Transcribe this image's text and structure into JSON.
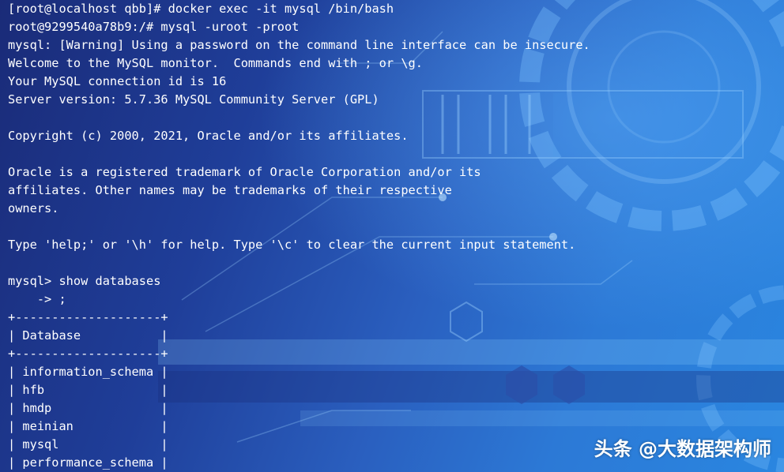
{
  "terminal": {
    "lines": [
      "[root@localhost qbb]# docker exec -it mysql /bin/bash",
      "root@9299540a78b9:/# mysql -uroot -proot",
      "mysql: [Warning] Using a password on the command line interface can be insecure.",
      "Welcome to the MySQL monitor.  Commands end with ; or \\g.",
      "Your MySQL connection id is 16",
      "Server version: 5.7.36 MySQL Community Server (GPL)",
      "",
      "Copyright (c) 2000, 2021, Oracle and/or its affiliates.",
      "",
      "Oracle is a registered trademark of Oracle Corporation and/or its",
      "affiliates. Other names may be trademarks of their respective",
      "owners.",
      "",
      "Type 'help;' or '\\h' for help. Type '\\c' to clear the current input statement.",
      "",
      "mysql> show databases",
      "    -> ;",
      "+--------------------+",
      "| Database           |",
      "+--------------------+",
      "| information_schema |",
      "| hfb                |",
      "| hmdp               |",
      "| meinian            |",
      "| mysql              |",
      "| performance_schema |"
    ],
    "text_color": "#ffffff"
  },
  "watermark": {
    "text": "头条 @大数据架构师"
  },
  "colors": {
    "bg_dark": "#1a2b78",
    "bg_light": "#2a86e0"
  }
}
